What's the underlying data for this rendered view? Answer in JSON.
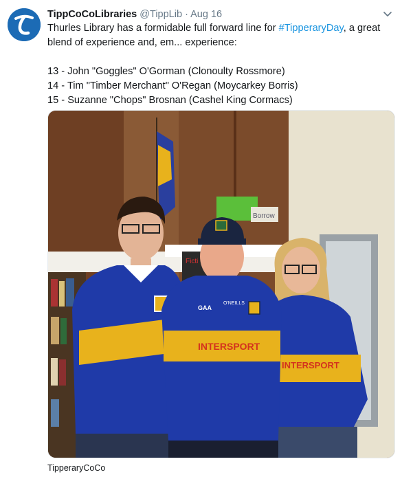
{
  "tweet": {
    "author_name": "TippCoCoLibraries",
    "author_handle": "@TippLib",
    "separator": "·",
    "timestamp": "Aug 16",
    "text_part1": "Thurles Library has a formidable full forward line for ",
    "hashtag": "#TipperaryDay",
    "text_part2": ", a great blend of experience and, em... experience:",
    "lines": [
      "13 - John \"Goggles\" O'Gorman (Clonoulty Rossmore)",
      "14 - Tim \"Timber Merchant\" O'Regan (Moycarkey Borris)",
      "15 - Suzanne \"Chops\" Brosnan (Cashel King Cormacs)"
    ],
    "photo_credit": "TipperaryCoCo"
  },
  "photo": {
    "sign_text": "Borrow",
    "shelf_text": "Ficti",
    "jersey_left_brand": "GAA",
    "jersey_brand": "O'NEILLS",
    "jersey_sponsor": "INTERSPORT"
  },
  "colors": {
    "link": "#1b95e0",
    "muted": "#657786",
    "avatar_bg": "#1c6bb5",
    "tipp_blue": "#1f3aa8",
    "tipp_gold": "#e8b21c"
  }
}
